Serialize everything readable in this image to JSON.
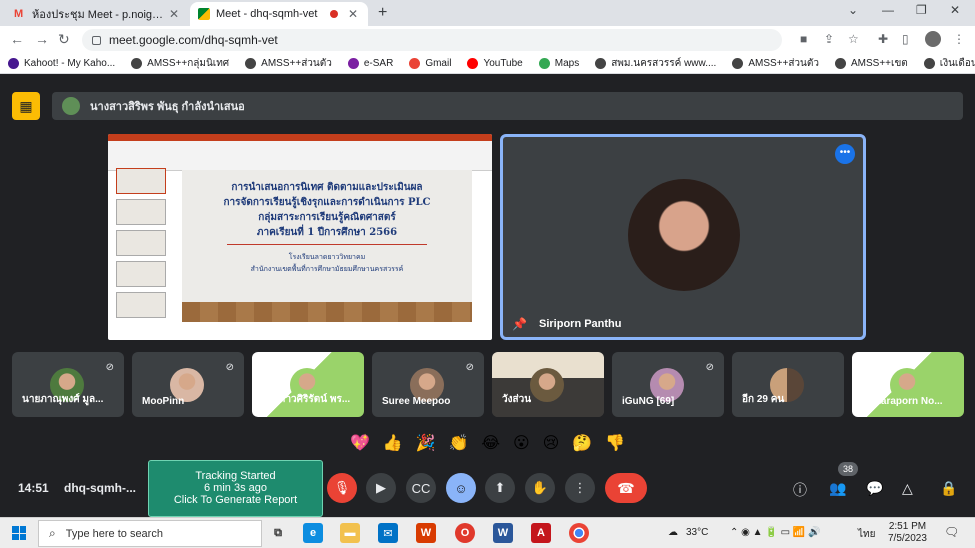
{
  "tabs": [
    {
      "label": "ห้องประชุม Meet - p.noigor@gmai..."
    },
    {
      "label": "Meet - dhq-sqmh-vet"
    }
  ],
  "address": {
    "url": "meet.google.com/dhq-sqmh-vet"
  },
  "bookmarks": [
    {
      "label": "Kahoot! - My Kaho...",
      "color": "#46178f"
    },
    {
      "label": "AMSS++กลุ่มนิเทศ",
      "color": "#444444"
    },
    {
      "label": "AMSS++ส่วนตัว",
      "color": "#444444"
    },
    {
      "label": "e-SAR",
      "color": "#7b1fa2"
    },
    {
      "label": "Gmail",
      "color": "#ea4335"
    },
    {
      "label": "YouTube",
      "color": "#ff0000"
    },
    {
      "label": "Maps",
      "color": "#34a853"
    },
    {
      "label": "สพม.นครสวรรค์ www....",
      "color": "#444444"
    },
    {
      "label": "AMSS++ส่วนตัว",
      "color": "#444444"
    },
    {
      "label": "AMSS++เขต",
      "color": "#444444"
    },
    {
      "label": "เงินเดือน",
      "color": "#444444"
    }
  ],
  "presenter_banner": {
    "text": "นางสาวสิริพร พันธุ กำลังนำเสนอ"
  },
  "slide": {
    "lines": [
      "การนำเสนอการนิเทศ ติดตามและประเมินผล",
      "การจัดการเรียนรู้เชิงรุกและการดำเนินการ PLC",
      "กลุ่มสาระการเรียนรู้คณิตศาสตร์",
      "ภาคเรียนที่ 1 ปีการศึกษา 2566"
    ],
    "school": "โรงเรียนลาดยาววิทยาคม",
    "office": "สำนักงานเขตพื้นที่การศึกษามัธยมศึกษานครสวรรค์"
  },
  "speaker": {
    "name": "Siriporn Panthu"
  },
  "participants": [
    {
      "name": "นายภาณุพงศ์ มูล...",
      "avatar_color": "#4e7a3e"
    },
    {
      "name": "MooPinn",
      "avatar_color": "#d9b7a4"
    },
    {
      "name": "นางสาวศิริรัตน์ พร...",
      "avatar_color": "#9ad36a"
    },
    {
      "name": "Suree Meepoo",
      "avatar_color": "#8a6e5a"
    },
    {
      "name": "วังส่วน",
      "avatar_color": "#6b5a3f"
    },
    {
      "name": "iGuNG [69]",
      "avatar_color": "#b58bb0"
    },
    {
      "name": "อีก 29 คน",
      "avatar_color": "#c9a07a"
    },
    {
      "name": "Pattaraporn No...",
      "avatar_color": "#9ad36a"
    }
  ],
  "reactions": [
    "💖",
    "👍",
    "🎉",
    "👏",
    "😂",
    "😮",
    "😢",
    "🤔",
    "👎"
  ],
  "bottom": {
    "time": "14:51",
    "meeting_code": "dhq-sqmh-...",
    "tracking": {
      "line1": "Tracking Started",
      "line2": "6 min 3s ago",
      "line3": "Click To Generate Report"
    },
    "people_count": "38"
  },
  "taskbar": {
    "search_placeholder": "Type here to search",
    "weather": "33°C",
    "language": "ไทย",
    "time": "2:51 PM",
    "date": "7/5/2023"
  }
}
